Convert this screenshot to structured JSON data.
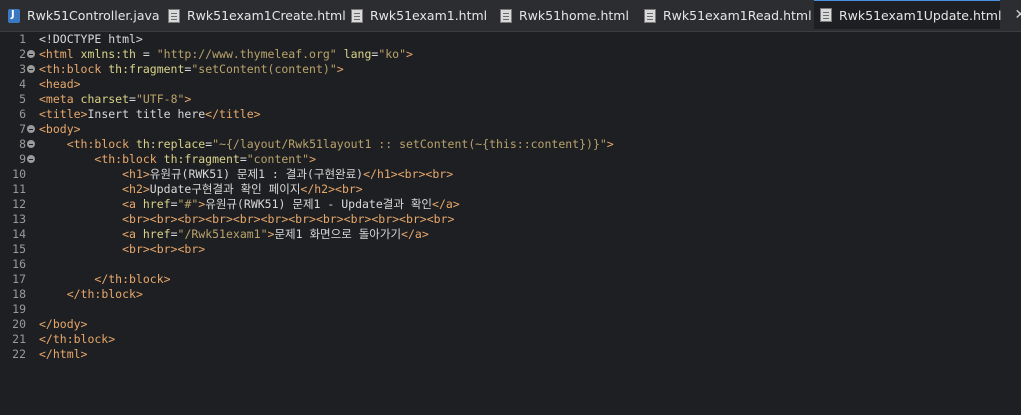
{
  "tabs": [
    {
      "label": "Rwk51Controller.java",
      "icon": "java-file-icon",
      "active": false
    },
    {
      "label": "Rwk51exam1Create.html",
      "icon": "html-file-icon",
      "active": false
    },
    {
      "label": "Rwk51exam1.html",
      "icon": "html-file-icon",
      "active": false
    },
    {
      "label": "Rwk51home.html",
      "icon": "html-file-icon",
      "active": false
    },
    {
      "label": "Rwk51exam1Read.html",
      "icon": "html-file-icon",
      "active": false
    },
    {
      "label": "Rwk51exam1Update.html",
      "icon": "html-file-icon",
      "active": true
    }
  ],
  "editor": {
    "lines": [
      {
        "n": "1",
        "fold": false,
        "segs": [
          [
            "k",
            "<!DOCTYPE html>"
          ]
        ]
      },
      {
        "n": "2",
        "fold": true,
        "segs": [
          [
            "t",
            "<html "
          ],
          [
            "a",
            "xmlns:th"
          ],
          [
            "k",
            " = "
          ],
          [
            "v",
            "\"http://www.thymeleaf.org\""
          ],
          [
            "k",
            " "
          ],
          [
            "a",
            "lang"
          ],
          [
            "k",
            "="
          ],
          [
            "v",
            "\"ko\""
          ],
          [
            "t",
            ">"
          ]
        ]
      },
      {
        "n": "3",
        "fold": true,
        "segs": [
          [
            "t",
            "<th:block "
          ],
          [
            "a",
            "th:fragment"
          ],
          [
            "k",
            "="
          ],
          [
            "v",
            "\"setContent(content)\""
          ],
          [
            "t",
            ">"
          ]
        ]
      },
      {
        "n": "4",
        "fold": false,
        "segs": [
          [
            "t",
            "<head>"
          ]
        ]
      },
      {
        "n": "5",
        "fold": false,
        "segs": [
          [
            "t",
            "<meta "
          ],
          [
            "a",
            "charset"
          ],
          [
            "k",
            "="
          ],
          [
            "v",
            "\"UTF-8\""
          ],
          [
            "t",
            ">"
          ]
        ]
      },
      {
        "n": "6",
        "fold": false,
        "segs": [
          [
            "t",
            "<title>"
          ],
          [
            "k",
            "Insert title here"
          ],
          [
            "t",
            "</title>"
          ]
        ]
      },
      {
        "n": "7",
        "fold": true,
        "segs": [
          [
            "t",
            "<body>"
          ]
        ]
      },
      {
        "n": "8",
        "fold": true,
        "segs": [
          [
            "k",
            "    "
          ],
          [
            "t",
            "<th:block "
          ],
          [
            "a",
            "th:replace"
          ],
          [
            "k",
            "="
          ],
          [
            "v",
            "\"~{/layout/Rwk51layout1 :: setContent(~{this::content})}\""
          ],
          [
            "t",
            ">"
          ]
        ]
      },
      {
        "n": "9",
        "fold": true,
        "segs": [
          [
            "k",
            "        "
          ],
          [
            "t",
            "<th:block "
          ],
          [
            "a",
            "th:fragment"
          ],
          [
            "k",
            "="
          ],
          [
            "v",
            "\"content\""
          ],
          [
            "t",
            ">"
          ]
        ]
      },
      {
        "n": "10",
        "fold": false,
        "segs": [
          [
            "k",
            "            "
          ],
          [
            "t",
            "<h1>"
          ],
          [
            "k",
            "유원규(RWK51) 문제1 : 결과(구현완료)"
          ],
          [
            "t",
            "</h1><br><br>"
          ]
        ]
      },
      {
        "n": "11",
        "fold": false,
        "segs": [
          [
            "k",
            "            "
          ],
          [
            "t",
            "<h2>"
          ],
          [
            "k",
            "Update구현결과 확인 페이지"
          ],
          [
            "t",
            "</h2><br>"
          ]
        ]
      },
      {
        "n": "12",
        "fold": false,
        "segs": [
          [
            "k",
            "            "
          ],
          [
            "t",
            "<a "
          ],
          [
            "a",
            "href"
          ],
          [
            "k",
            "="
          ],
          [
            "v",
            "\"#\""
          ],
          [
            "t",
            ">"
          ],
          [
            "k",
            "유원규(RWK51) 문제1 - Update결과 확인"
          ],
          [
            "t",
            "</a>"
          ]
        ]
      },
      {
        "n": "13",
        "fold": false,
        "segs": [
          [
            "k",
            "            "
          ],
          [
            "t",
            "<br><br><br><br><br><br><br><br><br><br><br><br>"
          ]
        ]
      },
      {
        "n": "14",
        "fold": false,
        "segs": [
          [
            "k",
            "            "
          ],
          [
            "t",
            "<a "
          ],
          [
            "a",
            "href"
          ],
          [
            "k",
            "="
          ],
          [
            "v",
            "\"/Rwk51exam1\""
          ],
          [
            "t",
            ">"
          ],
          [
            "k",
            "문제1 화면으로 돌아가기"
          ],
          [
            "t",
            "</a>"
          ]
        ]
      },
      {
        "n": "15",
        "fold": false,
        "segs": [
          [
            "k",
            "            "
          ],
          [
            "t",
            "<br><br><br>"
          ]
        ]
      },
      {
        "n": "16",
        "fold": false,
        "segs": []
      },
      {
        "n": "17",
        "fold": false,
        "segs": [
          [
            "k",
            "        "
          ],
          [
            "t",
            "</th:block>"
          ]
        ]
      },
      {
        "n": "18",
        "fold": false,
        "segs": [
          [
            "k",
            "    "
          ],
          [
            "t",
            "</th:block>"
          ]
        ]
      },
      {
        "n": "19",
        "fold": false,
        "segs": []
      },
      {
        "n": "20",
        "fold": false,
        "segs": [
          [
            "t",
            "</body>"
          ]
        ]
      },
      {
        "n": "21",
        "fold": false,
        "segs": [
          [
            "t",
            "</th:block>"
          ]
        ]
      },
      {
        "n": "22",
        "fold": false,
        "segs": [
          [
            "t",
            "</html>"
          ]
        ]
      }
    ]
  },
  "colors": {
    "tag": "#e8a86b",
    "attribute": "#d9d28a",
    "value": "#b9a36b",
    "text": "#cfcfcf",
    "background": "#1e1f22",
    "tabbar": "#2b2d30"
  }
}
